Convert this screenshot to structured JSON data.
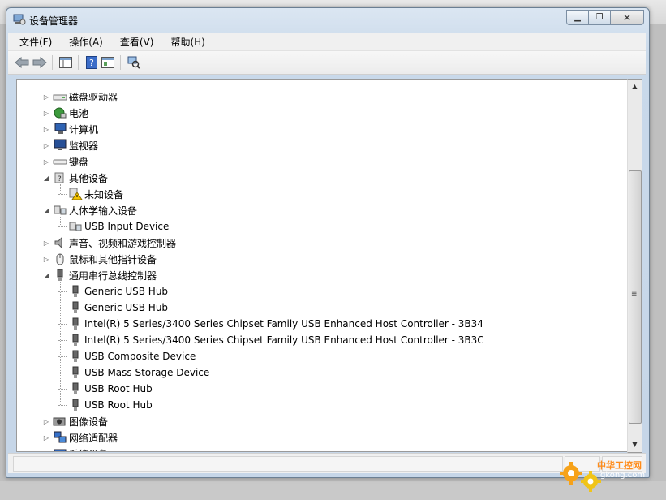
{
  "window": {
    "title": "设备管理器"
  },
  "menu": [
    "文件(F)",
    "操作(A)",
    "查看(V)",
    "帮助(H)"
  ],
  "toolbar": {
    "icons": [
      "back-arrow-icon",
      "forward-arrow-icon",
      "show-hide-console-tree-icon",
      "help-icon",
      "properties-icon",
      "scan-hardware-icon"
    ]
  },
  "tree": [
    {
      "label": "磁盘驱动器",
      "icon": "disk-drive-icon",
      "level": 0,
      "state": "collapsed"
    },
    {
      "label": "电池",
      "icon": "battery-icon",
      "level": 0,
      "state": "collapsed"
    },
    {
      "label": "计算机",
      "icon": "computer-icon",
      "level": 0,
      "state": "collapsed"
    },
    {
      "label": "监视器",
      "icon": "monitor-icon",
      "level": 0,
      "state": "collapsed"
    },
    {
      "label": "键盘",
      "icon": "keyboard-icon",
      "level": 0,
      "state": "collapsed"
    },
    {
      "label": "其他设备",
      "icon": "unknown-device-icon",
      "level": 0,
      "state": "expanded"
    },
    {
      "label": "未知设备",
      "icon": "warning-device-icon",
      "level": 1,
      "state": "leaf"
    },
    {
      "label": "人体学输入设备",
      "icon": "hid-icon",
      "level": 0,
      "state": "expanded"
    },
    {
      "label": "USB Input Device",
      "icon": "hid-icon",
      "level": 1,
      "state": "leaf"
    },
    {
      "label": "声音、视频和游戏控制器",
      "icon": "speaker-icon",
      "level": 0,
      "state": "collapsed"
    },
    {
      "label": "鼠标和其他指针设备",
      "icon": "mouse-icon",
      "level": 0,
      "state": "collapsed"
    },
    {
      "label": "通用串行总线控制器",
      "icon": "usb-icon",
      "level": 0,
      "state": "expanded"
    },
    {
      "label": "Generic USB Hub",
      "icon": "usb-icon",
      "level": 1,
      "state": "leaf"
    },
    {
      "label": "Generic USB Hub",
      "icon": "usb-icon",
      "level": 1,
      "state": "leaf"
    },
    {
      "label": "Intel(R) 5 Series/3400 Series Chipset Family USB Enhanced Host Controller - 3B34",
      "icon": "usb-icon",
      "level": 1,
      "state": "leaf"
    },
    {
      "label": "Intel(R) 5 Series/3400 Series Chipset Family USB Enhanced Host Controller - 3B3C",
      "icon": "usb-icon",
      "level": 1,
      "state": "leaf"
    },
    {
      "label": "USB Composite Device",
      "icon": "usb-icon",
      "level": 1,
      "state": "leaf"
    },
    {
      "label": "USB Mass Storage Device",
      "icon": "usb-icon",
      "level": 1,
      "state": "leaf"
    },
    {
      "label": "USB Root Hub",
      "icon": "usb-icon",
      "level": 1,
      "state": "leaf"
    },
    {
      "label": "USB Root Hub",
      "icon": "usb-icon",
      "level": 1,
      "state": "leaf"
    },
    {
      "label": "图像设备",
      "icon": "camera-icon",
      "level": 0,
      "state": "collapsed"
    },
    {
      "label": "网络适配器",
      "icon": "network-adapter-icon",
      "level": 0,
      "state": "collapsed"
    },
    {
      "label": "系统设备",
      "icon": "system-device-icon",
      "level": 0,
      "state": "collapsed"
    }
  ],
  "watermark": {
    "text": "中华工控网",
    "url": "gkong.com"
  }
}
